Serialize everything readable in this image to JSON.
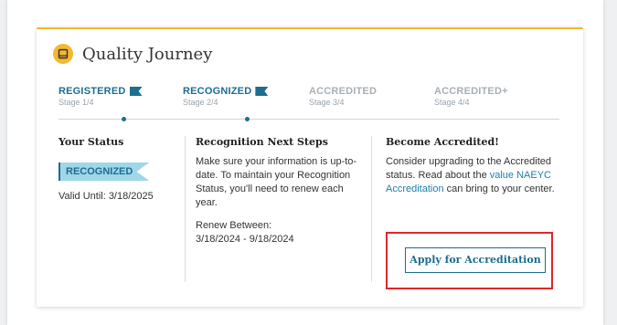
{
  "title": "Quality Journey",
  "stages": [
    {
      "name": "REGISTERED",
      "sub": "Stage 1/4",
      "active": true
    },
    {
      "name": "RECOGNIZED",
      "sub": "Stage 2/4",
      "active": true
    },
    {
      "name": "ACCREDITED",
      "sub": "Stage 3/4",
      "active": false
    },
    {
      "name": "ACCREDITED+",
      "sub": "Stage 4/4",
      "active": false
    }
  ],
  "status": {
    "heading": "Your Status",
    "badge": "RECOGNIZED",
    "valid": "Valid Until: 3/18/2025"
  },
  "next_steps": {
    "heading": "Recognition Next Steps",
    "body": "Make sure your information is up-to-date. To maintain your Recognition Status, you'll need to renew each year.",
    "renew_label": "Renew Between:",
    "renew_range": "3/18/2024 - 9/18/2024"
  },
  "accredit": {
    "heading": "Become Accredited!",
    "body_pre": "Consider upgrading to the Accredited status. Read about the ",
    "link": "value NAEYC Accreditation",
    "body_post": " can bring to your center.",
    "button": "Apply for Accreditation"
  },
  "colors": {
    "accent": "#f5b830",
    "brand": "#1d6d8f",
    "highlight": "#e0262b"
  }
}
